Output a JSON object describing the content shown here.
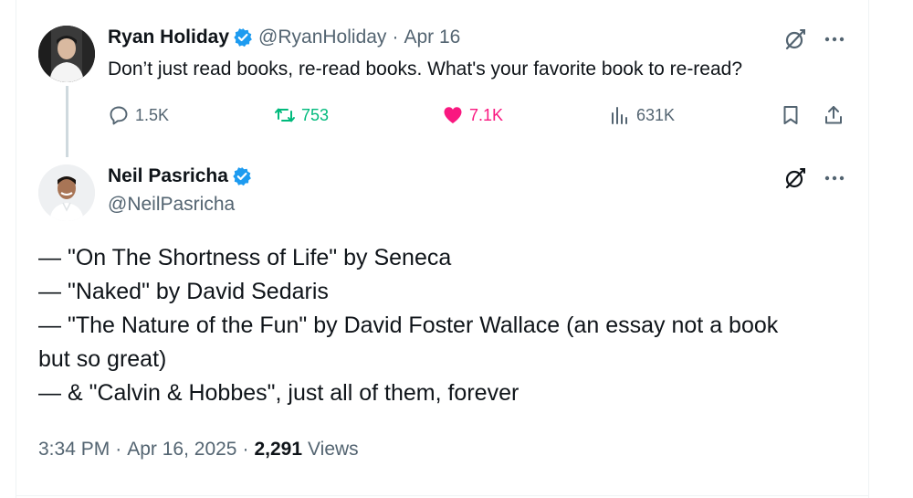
{
  "colors": {
    "text": "#0f1419",
    "muted": "#536471",
    "verified": "#1d9bf0",
    "retweet": "#00ba7c",
    "like": "#f91880",
    "thread_line": "#cfd9de"
  },
  "parent_tweet": {
    "author": {
      "display_name": "Ryan Holiday",
      "handle": "@RyanHoliday",
      "verified": true
    },
    "separator": "·",
    "date": "Apr 16",
    "text": "Don’t just read books, re-read books.  What's your favorite book to re-read?",
    "actions": {
      "reply_count": "1.5K",
      "retweet_count": "753",
      "like_count": "7.1K",
      "views_count": "631K"
    },
    "icons": [
      "grok-icon",
      "more-icon",
      "reply-icon",
      "retweet-icon",
      "heart-icon",
      "views-icon",
      "bookmark-icon",
      "share-icon"
    ]
  },
  "main_tweet": {
    "author": {
      "display_name": "Neil Pasricha",
      "handle": "@NeilPasricha",
      "verified": true
    },
    "lines": [
      "— \"On The Shortness of Life\" by Seneca",
      "— \"Naked\" by David Sedaris",
      "— \"The Nature of the Fun\" by David Foster Wallace (an essay not a book",
      "but so great)",
      "— & \"Calvin & Hobbes\", just all of them, forever"
    ],
    "meta": {
      "time": "3:34 PM",
      "separator": "·",
      "date": "Apr 16, 2025",
      "views_count": "2,291",
      "views_label": "Views"
    }
  }
}
